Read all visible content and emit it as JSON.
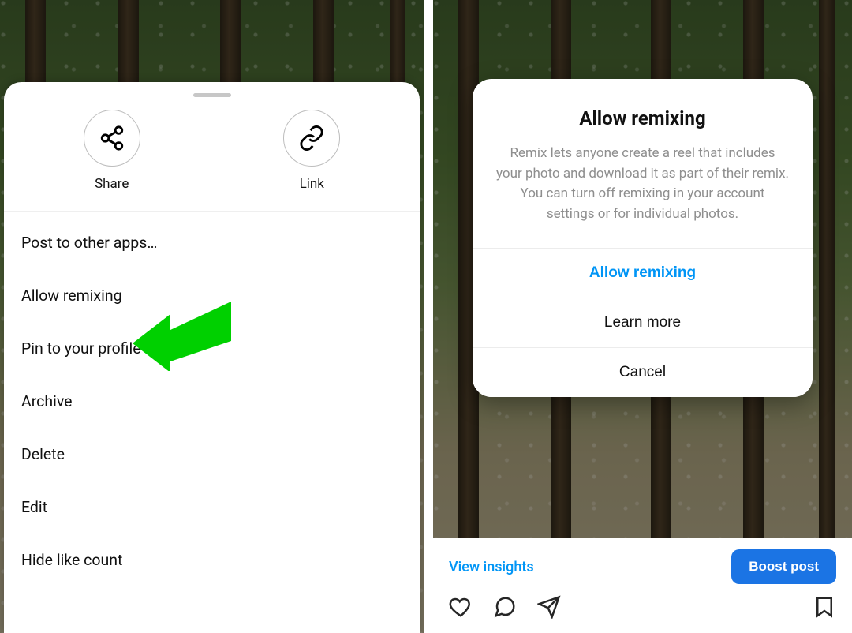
{
  "left": {
    "share_label": "Share",
    "link_label": "Link",
    "menu_items": [
      "Post to other apps…",
      "Allow remixing",
      "Pin to your profile",
      "Archive",
      "Delete",
      "Edit",
      "Hide like count"
    ],
    "arrow_color": "#00d000"
  },
  "right": {
    "dialog": {
      "title": "Allow remixing",
      "body": "Remix lets anyone create a reel that includes your photo and download it as part of their remix. You can turn off remixing in your account settings or for individual photos.",
      "primary_label": "Allow remixing",
      "learn_label": "Learn more",
      "cancel_label": "Cancel"
    },
    "post": {
      "insights_label": "View insights",
      "boost_label": "Boost post"
    }
  },
  "colors": {
    "accent": "#0095f6",
    "boost": "#1b74e4"
  }
}
